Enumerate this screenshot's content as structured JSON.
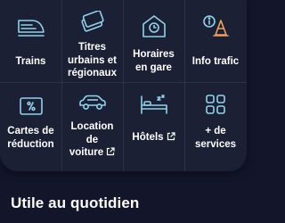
{
  "services": {
    "trains": "Trains",
    "titres_l1": "Titres",
    "titres_l2": "urbains et",
    "titres_l3": "régionaux",
    "horaires_l1": "Horaires",
    "horaires_l2": "en gare",
    "info_trafic": "Info trafic",
    "cartes_l1": "Cartes de",
    "cartes_l2": "réduction",
    "location_l1": "Location",
    "location_l2": "de",
    "location_l3": "voiture",
    "hotels": "Hôtels",
    "plus_l1": "+ de",
    "plus_l2": "services"
  },
  "section": {
    "title": "Utile au quotidien"
  },
  "colors": {
    "background": "#13152b",
    "card": "#1c2034",
    "icon_accent": "#8fd3ec",
    "divider": "#2c3148",
    "text": "#ffffff"
  }
}
